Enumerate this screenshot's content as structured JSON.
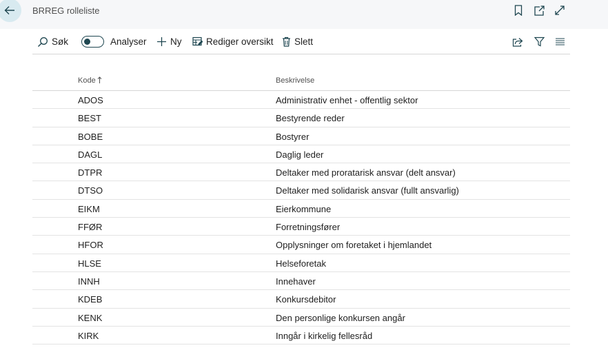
{
  "header": {
    "title": "BRREG rolleliste",
    "icons": [
      "back-arrow-icon",
      "bookmark-icon",
      "open-new-window-icon",
      "expand-icon"
    ]
  },
  "toolbar": {
    "search_label": "Søk",
    "analyze_label": "Analyser",
    "analyze_on": false,
    "new_label": "Ny",
    "edit_list_label": "Rediger oversikt",
    "delete_label": "Slett"
  },
  "colors": {
    "accent": "#1e4650",
    "back_button_bg": "#d8eaf0",
    "header_bg": "#f6f7f9"
  },
  "table": {
    "columns": [
      {
        "label": "Kode",
        "sort": "ascending"
      },
      {
        "label": "Beskrivelse"
      }
    ],
    "rows": [
      {
        "code": "ADOS",
        "description": "Administrativ enhet - offentlig sektor"
      },
      {
        "code": "BEST",
        "description": "Bestyrende reder"
      },
      {
        "code": "BOBE",
        "description": "Bostyrer"
      },
      {
        "code": "DAGL",
        "description": "Daglig leder"
      },
      {
        "code": "DTPR",
        "description": "Deltaker med proratarisk ansvar (delt ansvar)"
      },
      {
        "code": "DTSO",
        "description": "Deltaker med solidarisk ansvar (fullt ansvarlig)"
      },
      {
        "code": "EIKM",
        "description": "Eierkommune"
      },
      {
        "code": "FFØR",
        "description": "Forretningsfører"
      },
      {
        "code": "HFOR",
        "description": "Opplysninger om foretaket i hjemlandet"
      },
      {
        "code": "HLSE",
        "description": "Helseforetak"
      },
      {
        "code": "INNH",
        "description": "Innehaver"
      },
      {
        "code": "KDEB",
        "description": "Konkursdebitor"
      },
      {
        "code": "KENK",
        "description": "Den personlige konkursen angår"
      },
      {
        "code": "KIRK",
        "description": "Inngår i kirkelig fellesråd"
      }
    ]
  }
}
